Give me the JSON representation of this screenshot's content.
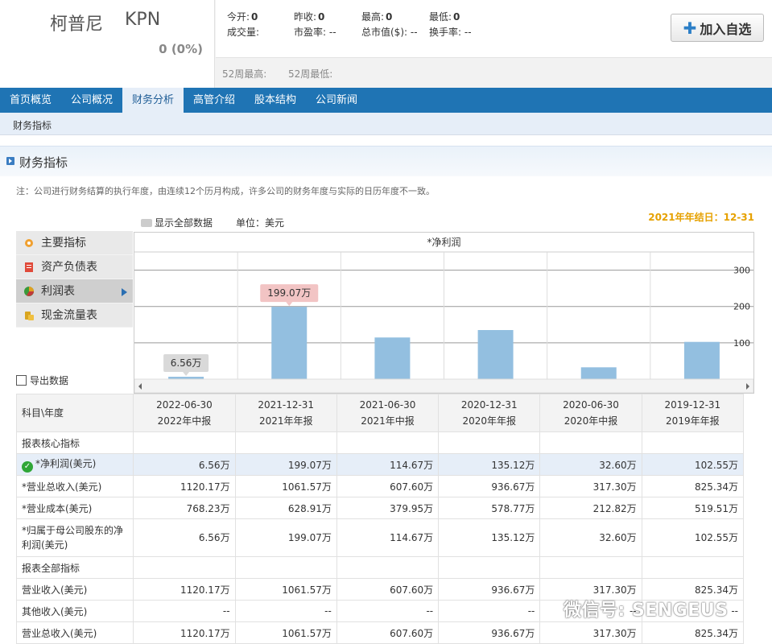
{
  "header": {
    "name_cn": "柯普尼",
    "code": "KPN",
    "change": "0 (0%)",
    "quote": [
      {
        "label": "今开:",
        "value": "0"
      },
      {
        "label": "昨收:",
        "value": "0"
      },
      {
        "label": "最高:",
        "value": "0"
      },
      {
        "label": "最低:",
        "value": "0"
      },
      {
        "label": "成交量:",
        "value": ""
      },
      {
        "label": "市盈率:",
        "value": "--"
      },
      {
        "label": "总市值($):",
        "value": "--"
      },
      {
        "label": "换手率:",
        "value": "--"
      }
    ],
    "week52_high_label": "52周最高:",
    "week52_low_label": "52周最低:",
    "add_button": "加入自选"
  },
  "nav": {
    "items": [
      "首页概览",
      "公司概况",
      "财务分析",
      "高管介绍",
      "股本结构",
      "公司新闻"
    ],
    "active": 2
  },
  "subnav": {
    "label": "财务指标"
  },
  "section": {
    "title": "财务指标",
    "note": "注：公司进行财务结算的执行年度，由连续12个历月构成，许多公司的财务年度与实际的日历年度不一致。",
    "show_all": "显示全部数据",
    "unit": "单位：美元",
    "fiscal_year_end": "2021年年结日：12-31",
    "export": "导出数据"
  },
  "menu": [
    {
      "label": "主要指标",
      "icon": "gear-icon"
    },
    {
      "label": "资产负债表",
      "icon": "document-icon"
    },
    {
      "label": "利润表",
      "icon": "pie-chart-icon",
      "active": true
    },
    {
      "label": "现金流量表",
      "icon": "coins-icon"
    }
  ],
  "chart_data": {
    "type": "bar",
    "title": "*净利润",
    "categories": [
      "2022-06-30",
      "2021-12-31",
      "2021-06-30",
      "2020-12-31",
      "2020-06-30",
      "2019-12-31"
    ],
    "values": [
      6.56,
      199.07,
      114.67,
      135.12,
      32.6,
      102.55
    ],
    "ylim": [
      0,
      350
    ],
    "yticks": [
      100,
      200,
      300
    ],
    "data_labels": [
      {
        "index": 0,
        "text": "6.56万"
      },
      {
        "index": 1,
        "text": "199.07万"
      }
    ],
    "bar_color": "#93bfe0",
    "grid": true
  },
  "table": {
    "header_label": "科目\\年度",
    "columns": [
      {
        "date": "2022-06-30",
        "type": "2022年中报"
      },
      {
        "date": "2021-12-31",
        "type": "2021年年报"
      },
      {
        "date": "2021-06-30",
        "type": "2021年中报"
      },
      {
        "date": "2020-12-31",
        "type": "2020年年报"
      },
      {
        "date": "2020-06-30",
        "type": "2020年中报"
      },
      {
        "date": "2019-12-31",
        "type": "2019年年报"
      }
    ],
    "rows": [
      {
        "section": "报表核心指标"
      },
      {
        "label": "*净利润(美元)",
        "values": [
          "6.56万",
          "199.07万",
          "114.67万",
          "135.12万",
          "32.60万",
          "102.55万"
        ],
        "selected": true
      },
      {
        "label": "*营业总收入(美元)",
        "values": [
          "1120.17万",
          "1061.57万",
          "607.60万",
          "936.67万",
          "317.30万",
          "825.34万"
        ]
      },
      {
        "label": "*营业成本(美元)",
        "values": [
          "768.23万",
          "628.91万",
          "379.95万",
          "578.77万",
          "212.82万",
          "519.51万"
        ]
      },
      {
        "label": "*归属于母公司股东的净利润(美元)",
        "values": [
          "6.56万",
          "199.07万",
          "114.67万",
          "135.12万",
          "32.60万",
          "102.55万"
        ],
        "tall": true
      },
      {
        "section": "报表全部指标"
      },
      {
        "label": "营业收入(美元)",
        "values": [
          "1120.17万",
          "1061.57万",
          "607.60万",
          "936.67万",
          "317.30万",
          "825.34万"
        ]
      },
      {
        "label": "其他收入(美元)",
        "values": [
          "--",
          "--",
          "--",
          "--",
          "--",
          "--"
        ]
      },
      {
        "label": "营业总收入(美元)",
        "values": [
          "1120.17万",
          "1061.57万",
          "607.60万",
          "936.67万",
          "317.30万",
          "825.34万"
        ]
      }
    ]
  },
  "watermark": "微信号: SENGEUS"
}
